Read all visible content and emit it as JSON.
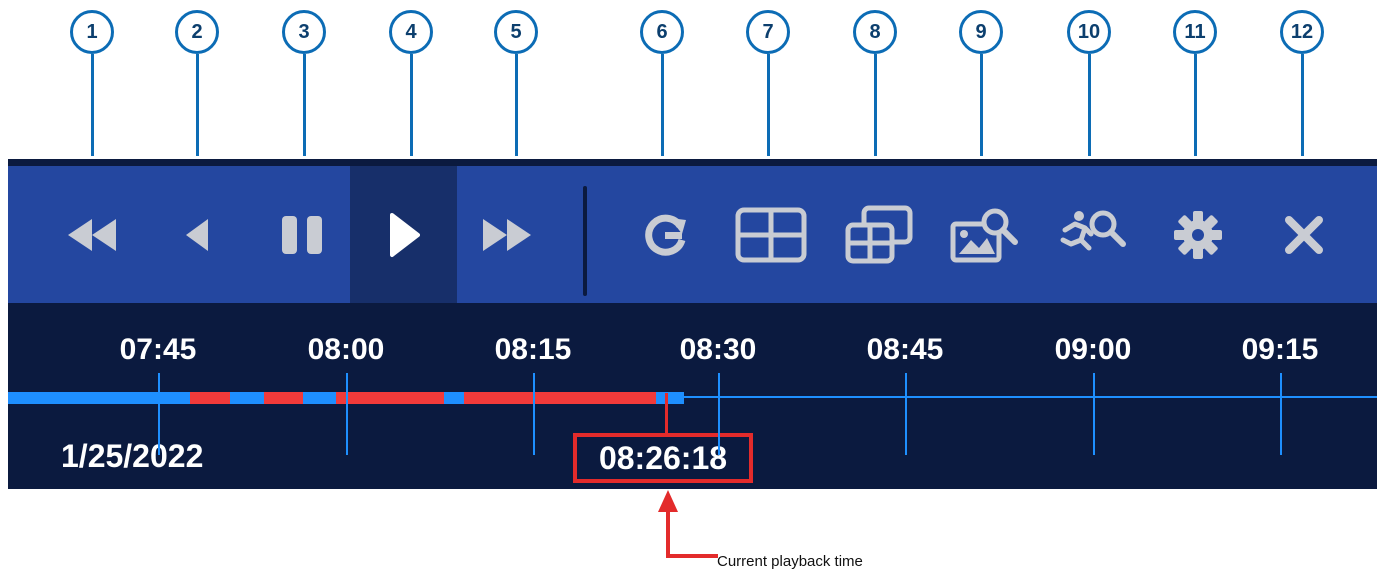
{
  "callouts": [
    "1",
    "2",
    "3",
    "4",
    "5",
    "6",
    "7",
    "8",
    "9",
    "10",
    "11",
    "12"
  ],
  "toolbar": {
    "buttons": [
      {
        "name": "rewind-button",
        "icon": "rewind-icon"
      },
      {
        "name": "reverse-play-button",
        "icon": "reverse-play-icon"
      },
      {
        "name": "pause-button",
        "icon": "pause-icon"
      },
      {
        "name": "play-button",
        "icon": "play-icon",
        "active": true
      },
      {
        "name": "fast-forward-button",
        "icon": "fast-forward-icon"
      },
      {
        "name": "sync-button",
        "icon": "sync-icon"
      },
      {
        "name": "split-screen-button",
        "icon": "grid-icon"
      },
      {
        "name": "multi-view-button",
        "icon": "multi-grid-icon"
      },
      {
        "name": "image-search-button",
        "icon": "image-search-icon"
      },
      {
        "name": "motion-search-button",
        "icon": "motion-search-icon"
      },
      {
        "name": "settings-button",
        "icon": "gear-icon"
      },
      {
        "name": "close-button",
        "icon": "close-icon"
      }
    ]
  },
  "timeline": {
    "ticks": [
      "07:45",
      "08:00",
      "08:15",
      "08:30",
      "08:45",
      "09:00",
      "09:15"
    ],
    "date": "1/25/2022",
    "current_time": "08:26:18",
    "recording_colors": {
      "continuous": "#1e8fff",
      "motion": "#f23a3a"
    }
  },
  "annotation": {
    "label": "Current playback time"
  }
}
